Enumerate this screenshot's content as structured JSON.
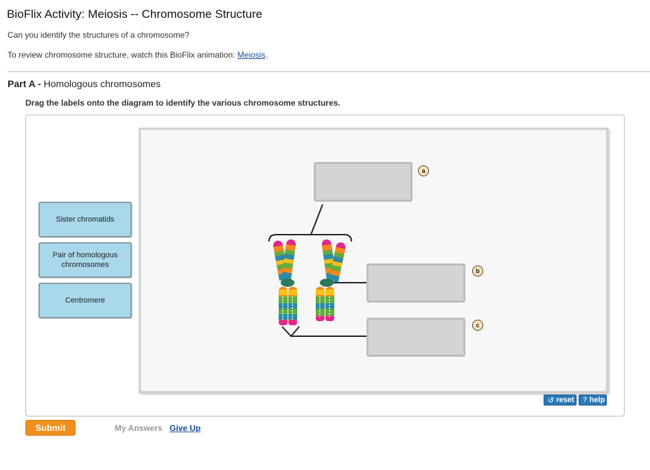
{
  "header": {
    "title": "BioFlix Activity: Meiosis -- Chromosome Structure",
    "question": "Can you identify the structures of a chromosome?",
    "review_prefix": "To review chromosome structure, watch this BioFlix animation: ",
    "review_link": "Meiosis",
    "review_suffix": "."
  },
  "part": {
    "label": "Part A - ",
    "title": "Homologous chromosomes",
    "instructions": "Drag the labels onto the diagram to identify the various chromosome structures."
  },
  "labels": [
    {
      "text": "Sister chromatids"
    },
    {
      "text": "Pair of homologous chromosomes"
    },
    {
      "text": "Centromere"
    }
  ],
  "targets": [
    {
      "marker": "a",
      "value": ""
    },
    {
      "marker": "b",
      "value": ""
    },
    {
      "marker": "c",
      "value": ""
    }
  ],
  "controls": {
    "reset_label": "reset",
    "help_label": "help",
    "reset_icon": "refresh-icon",
    "help_icon": "question-icon",
    "color": "#2b78b6"
  },
  "footer": {
    "submit_label": "Submit",
    "my_answers_label": "My Answers",
    "give_up_label": "Give Up",
    "submit_color": "#ef8f1d"
  }
}
